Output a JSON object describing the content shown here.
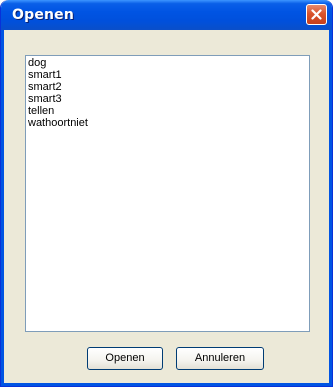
{
  "window": {
    "title": "Openen",
    "close_icon": "close-icon"
  },
  "list": {
    "items": [
      "dog",
      "smart1",
      "smart2",
      "smart3",
      "tellen",
      "wathoortniet"
    ]
  },
  "buttons": {
    "open_label": "Openen",
    "cancel_label": "Annuleren"
  },
  "colors": {
    "titlebar": "#0054e3",
    "close_button": "#d9532c",
    "dialog_background": "#ece9d8"
  }
}
